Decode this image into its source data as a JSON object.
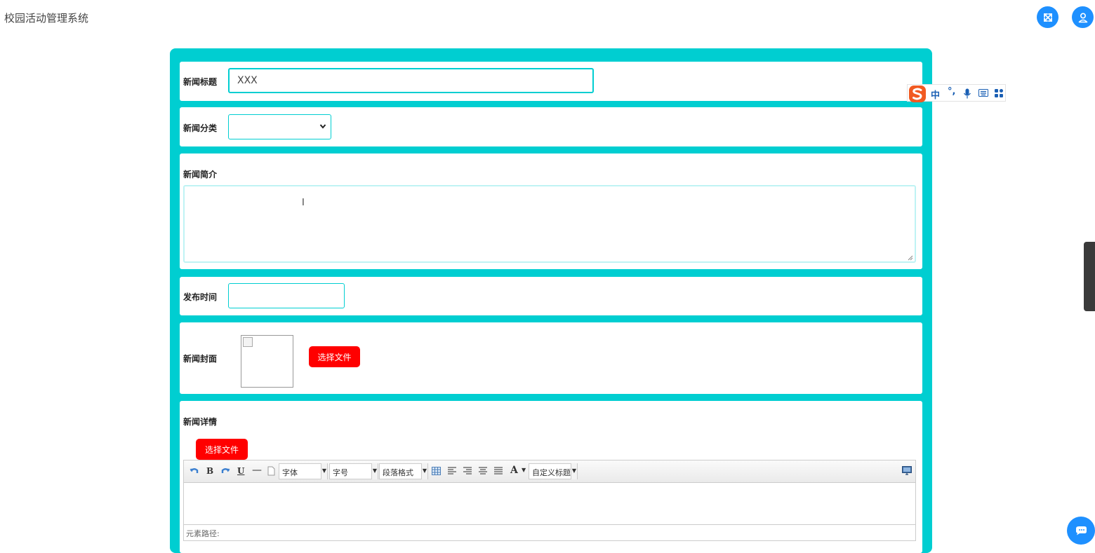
{
  "app": {
    "title": "校园活动管理系统"
  },
  "header": {
    "fullscreen_icon": "expand-arrows-icon",
    "user_icon": "user-icon"
  },
  "form": {
    "title_label": "新闻标题",
    "title_value": "XXX",
    "category_label": "新闻分类",
    "category_value": "",
    "summary_label": "新闻简介",
    "summary_value": "",
    "time_label": "发布时间",
    "time_value": "",
    "cover_label": "新闻封面",
    "cover_button": "选择文件",
    "detail_label": "新闻详情",
    "detail_button": "选择文件"
  },
  "editor": {
    "font_family": "字体",
    "font_size": "字号",
    "paragraph": "段落格式",
    "custom_title": "自定义标题",
    "status_path": "元素路径:"
  },
  "ime": {
    "mode": "中",
    "punct": "°,",
    "icons": [
      "sogou-logo-icon",
      "mic-icon",
      "keyboard-icon",
      "apps-grid-icon"
    ]
  },
  "colors": {
    "accent": "#00ced1",
    "primary": "#1e90ff",
    "danger": "#ff0000"
  }
}
